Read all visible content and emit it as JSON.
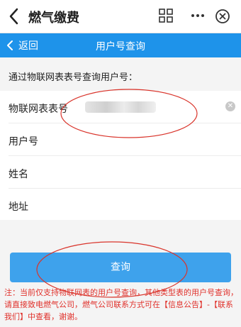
{
  "app": {
    "title": "燃气缴费"
  },
  "nav": {
    "back_label": "返回",
    "title": "用户号查询"
  },
  "form": {
    "hint": "通过物联网表表号查询用户号：",
    "fields": [
      {
        "label": "物联网表表号",
        "value": ""
      },
      {
        "label": "用户号",
        "value": ""
      },
      {
        "label": "姓名",
        "value": ""
      },
      {
        "label": "地址",
        "value": ""
      }
    ]
  },
  "actions": {
    "query_label": "查询"
  },
  "note": "注：当前仅支持物联网表的用户号查询，其他类型表的用户号查询，请直接致电燃气公司，燃气公司联系方式可在【信息公告】-【联系我们】中查看，谢谢。",
  "colors": {
    "nav_bg": "#1e93ea",
    "button_bg": "#3ea2ec",
    "note_text": "#e0312b",
    "annotation": "#d9342b"
  }
}
